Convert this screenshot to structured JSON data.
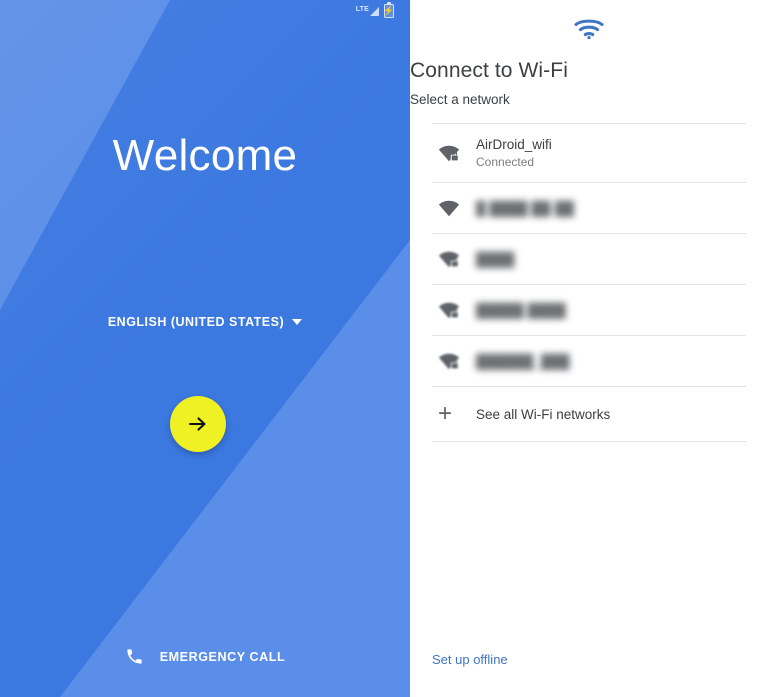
{
  "colors": {
    "brand_blue": "#3b78e0",
    "brand_blue_light": "#5b8ee8",
    "accent_yellow": "#eff125",
    "wifi_icon_blue": "#3f76c4",
    "link_blue": "#3f76c4",
    "divider": "#e3e3e3",
    "text_primary": "#3c4043",
    "text_secondary": "#7a7d80"
  },
  "left_panel": {
    "status_bar": {
      "network_type": "LTE",
      "signal_icon": "signal-triangle-icon",
      "battery_icon": "battery-charging-icon",
      "battery_bolt": "⚡"
    },
    "welcome_title": "Welcome",
    "language": {
      "label": "ENGLISH (UNITED STATES)",
      "caret_icon": "chevron-down-icon"
    },
    "next_button": {
      "icon": "arrow-right-icon",
      "label": ""
    },
    "emergency": {
      "icon": "phone-icon",
      "label": "EMERGENCY CALL"
    }
  },
  "right_panel": {
    "hero_icon": "wifi-icon",
    "title": "Connect to Wi-Fi",
    "subtitle": "Select a network",
    "networks": [
      {
        "name": "AirDroid_wifi",
        "status": "Connected",
        "secured": true,
        "redacted": false
      },
      {
        "name": "█ ████ ██-██",
        "status": "",
        "secured": false,
        "redacted": true
      },
      {
        "name": "████",
        "status": "",
        "secured": true,
        "redacted": true
      },
      {
        "name": "█████ ████",
        "status": "",
        "secured": true,
        "redacted": true
      },
      {
        "name": "██████_███",
        "status": "",
        "secured": true,
        "redacted": true
      }
    ],
    "see_all": {
      "icon": "plus-icon",
      "label": "See all Wi-Fi networks"
    },
    "offline_link": "Set up offline"
  }
}
